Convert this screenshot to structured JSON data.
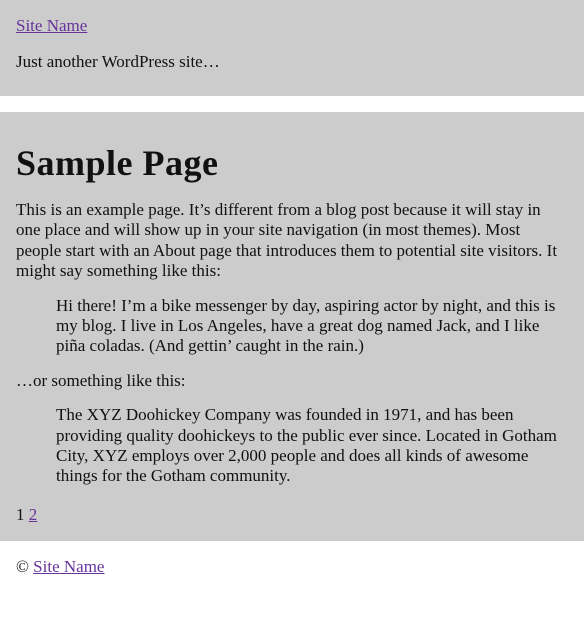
{
  "header": {
    "site_title": "Site Name",
    "tagline": "Just another WordPress site…"
  },
  "page": {
    "title": "Sample Page",
    "intro": "This is an example page. It’s different from a blog post because it will stay in one place and will show up in your site navigation (in most themes). Most people start with an About page that introduces them to potential site visitors. It might say something like this:",
    "quote1": "Hi there! I’m a bike messenger by day, aspiring actor by night, and this is my blog. I live in Los Angeles, have a great dog named Jack, and I like piña coladas. (And gettin’ caught in the rain.)",
    "middle": "…or something like this:",
    "quote2": "The XYZ Doohickey Company was founded in 1971, and has been providing quality doohickeys to the public ever since. Located in Gotham City, XYZ employs over 2,000 people and does all kinds of awesome things for the Gotham community."
  },
  "pagination": {
    "current": "1",
    "next": "2"
  },
  "footer": {
    "copyright": "©",
    "site_link": "Site Name"
  }
}
